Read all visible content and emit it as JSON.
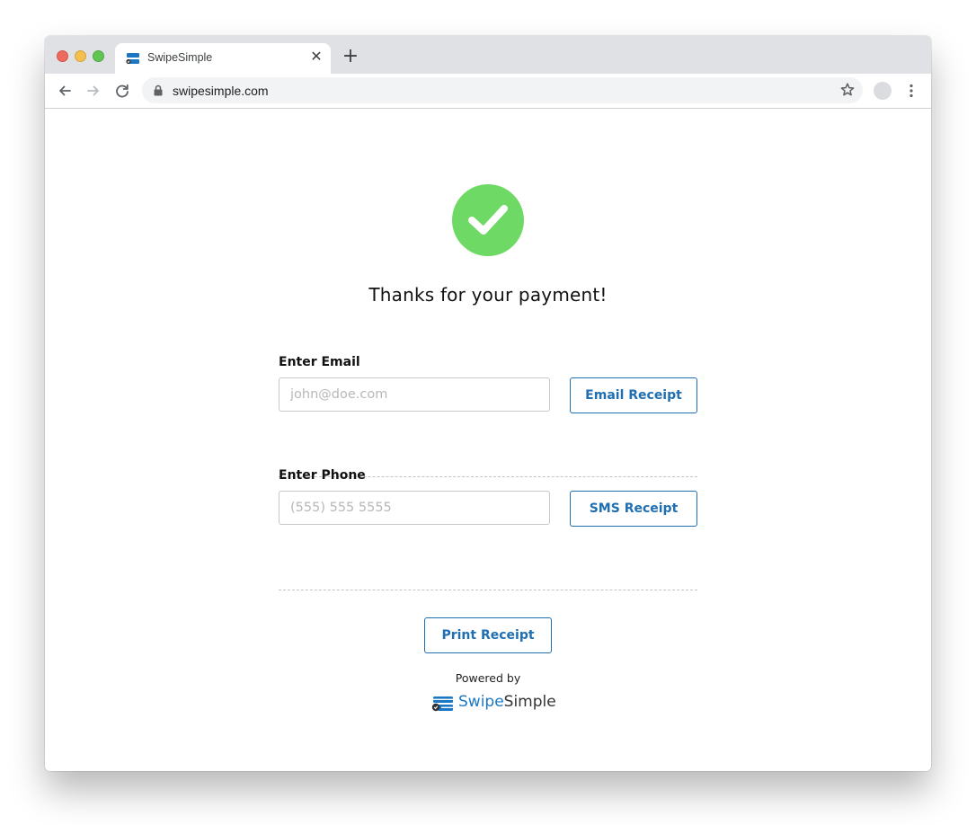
{
  "browser": {
    "tab_title": "SwipeSimple",
    "tab_close": "✕",
    "new_tab": "+",
    "url": "swipesimple.com"
  },
  "page": {
    "heading": "Thanks for your payment!",
    "email": {
      "label": "Enter Email",
      "placeholder": "john@doe.com",
      "button": "Email Receipt"
    },
    "phone": {
      "label": "Enter Phone",
      "placeholder": "(555) 555 5555",
      "button": "SMS Receipt"
    },
    "print_button": "Print Receipt",
    "powered_by": "Powered by",
    "brand": {
      "part1": "Swipe",
      "part2": "Simple"
    }
  },
  "colors": {
    "success_green": "#6fd965",
    "accent_blue": "#1f6fb2",
    "brand_blue": "#1b77c4"
  },
  "icons": [
    "check-icon",
    "back-arrow-icon",
    "forward-arrow-icon",
    "reload-icon",
    "lock-icon",
    "star-icon",
    "kebab-menu-icon",
    "swipesimple-logo-icon"
  ]
}
